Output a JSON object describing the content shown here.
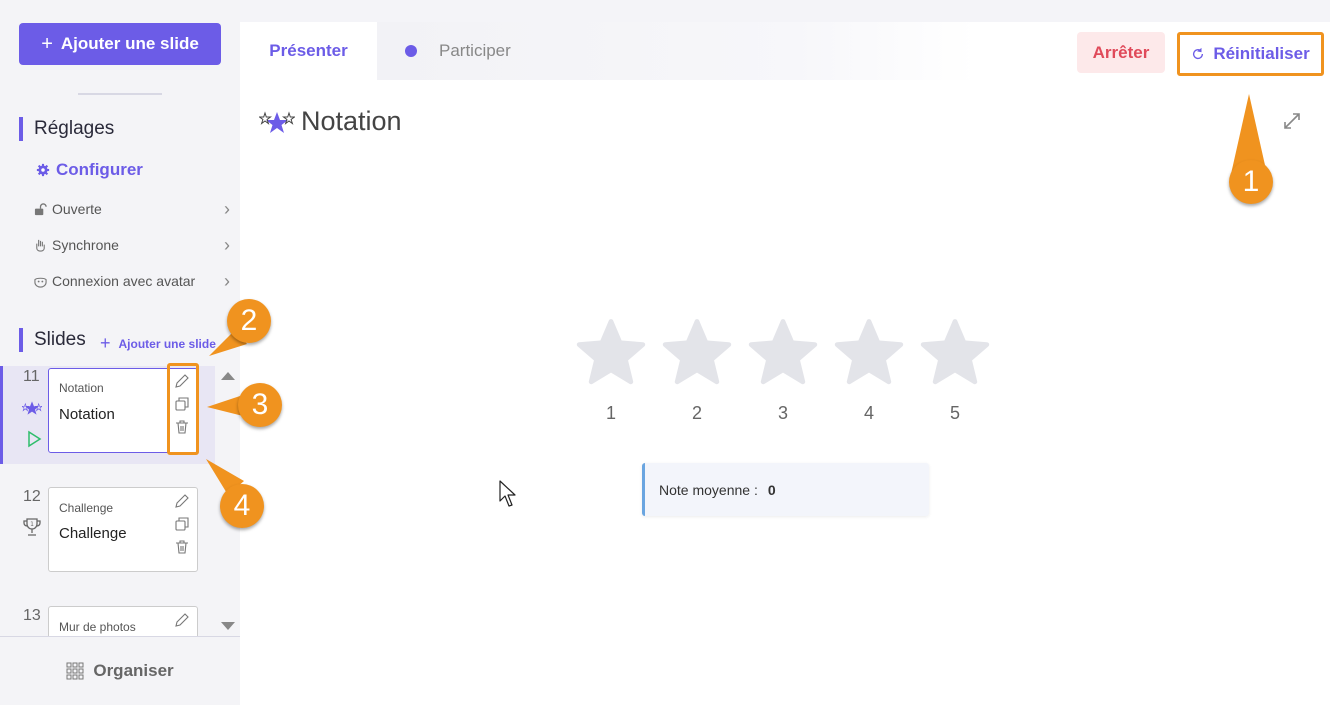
{
  "sidebar": {
    "add_slide_label": "Ajouter une slide",
    "settings_title": "Réglages",
    "configure_label": "Configurer",
    "menu": [
      {
        "label": "Ouverte",
        "icon": "lock-open-icon"
      },
      {
        "label": "Synchrone",
        "icon": "hand-icon"
      },
      {
        "label": "Connexion avec avatar",
        "icon": "mask-icon"
      }
    ],
    "slides_title": "Slides",
    "slides_add_label": "Ajouter une slide",
    "slides": [
      {
        "number": "11",
        "type": "Notation",
        "title": "Notation",
        "icon": "stars-icon",
        "active": true
      },
      {
        "number": "12",
        "type": "Challenge",
        "title": "Challenge",
        "icon": "trophy-icon",
        "active": false
      },
      {
        "number": "13",
        "type": "Mur de photos",
        "title": "",
        "icon": "",
        "active": false
      }
    ],
    "organize_label": "Organiser"
  },
  "header": {
    "tab_present": "Présenter",
    "tab_participate": "Participer",
    "stop_label": "Arrêter",
    "reset_label": "Réinitialiser"
  },
  "main": {
    "title": "Notation",
    "ratings": [
      "1",
      "2",
      "3",
      "4",
      "5"
    ],
    "average_label": "Note moyenne :",
    "average_value": "0"
  },
  "callouts": [
    "1",
    "2",
    "3",
    "4"
  ],
  "colors": {
    "accent": "#6c5ce7",
    "highlight": "#f0931f",
    "stop": "#e04a5a",
    "star": "#e3e4e9"
  }
}
